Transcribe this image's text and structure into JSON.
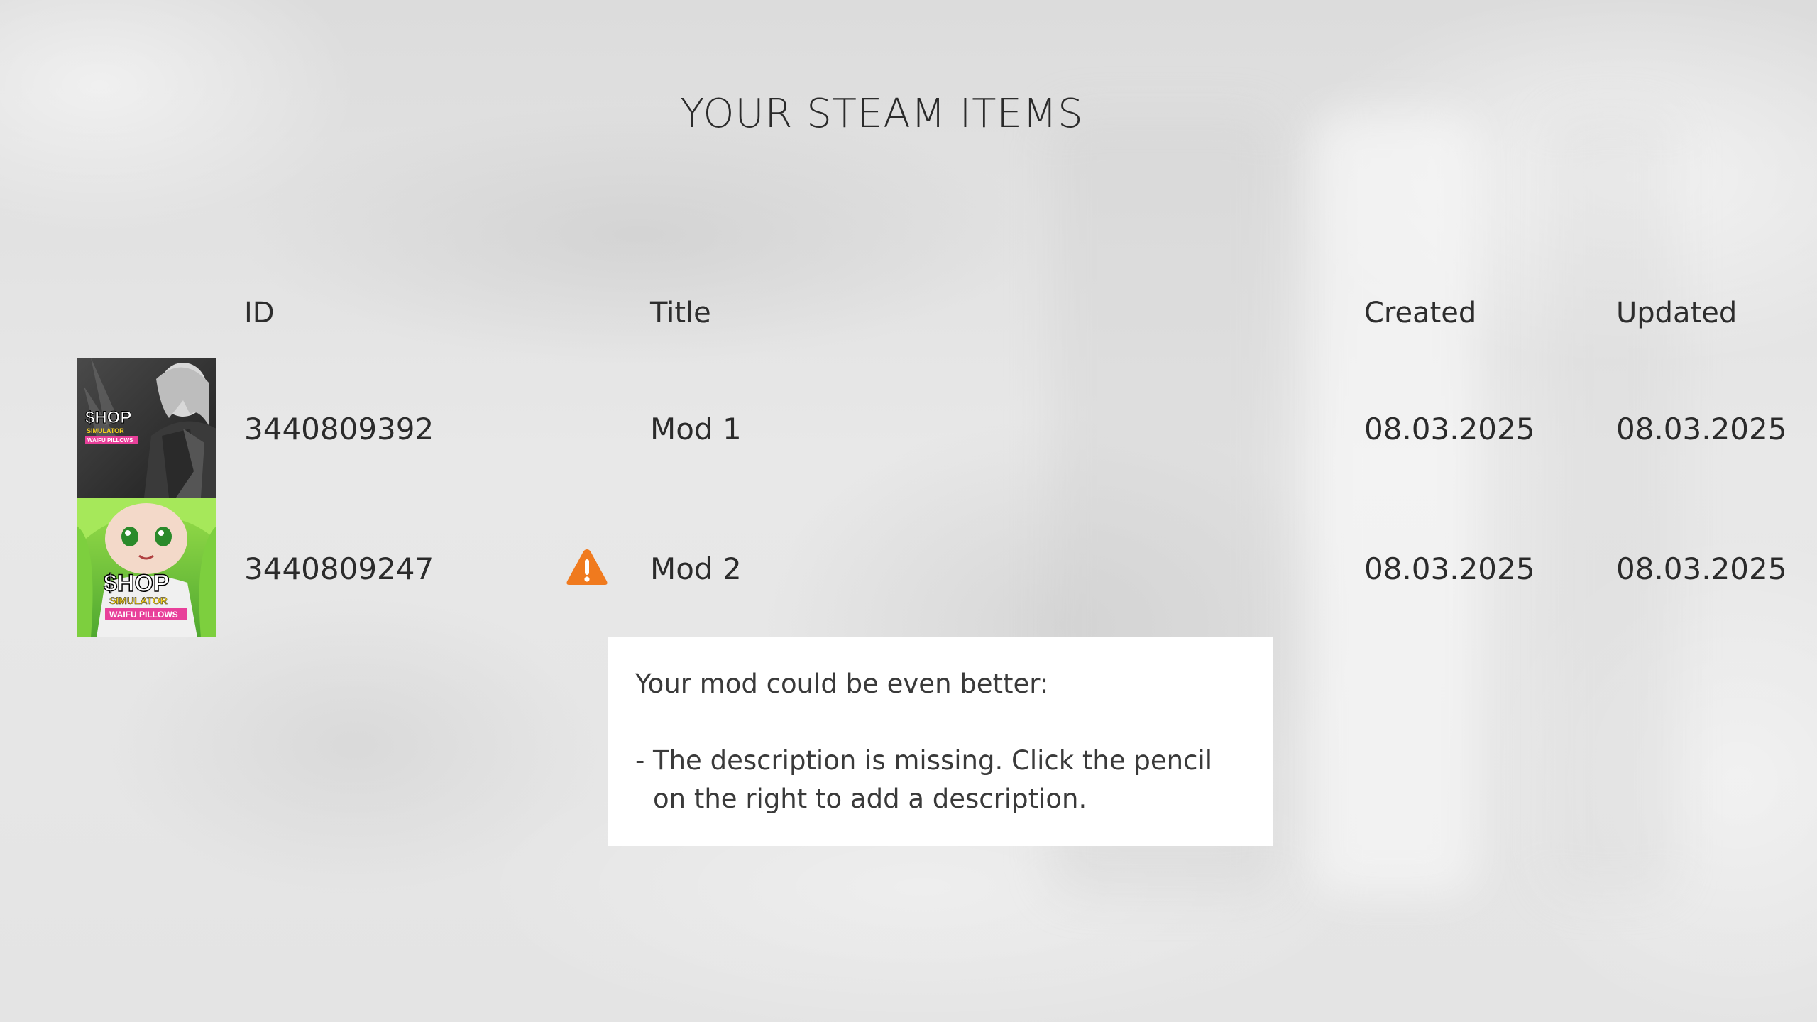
{
  "page": {
    "title": "YOUR STEAM ITEMS"
  },
  "table": {
    "columns": {
      "id": "ID",
      "title": "Title",
      "created": "Created",
      "updated": "Updated"
    },
    "rows": [
      {
        "id": "3440809392",
        "title": "Mod 1",
        "created": "08.03.2025",
        "updated": "08.03.2025",
        "warning": false,
        "thumbnail": {
          "logo_line1": "$HOP",
          "logo_line2": "SIMULATOR",
          "logo_line3": "WAIFU PILLOWS",
          "style": "grayscale"
        }
      },
      {
        "id": "3440809247",
        "title": "Mod 2",
        "created": "08.03.2025",
        "updated": "08.03.2025",
        "warning": true,
        "warning_icon": "warning-triangle-icon",
        "thumbnail": {
          "logo_line1": "$HOP",
          "logo_line2": "SIMULATOR",
          "logo_line3": "WAIFU PILLOWS",
          "style": "green"
        }
      }
    ]
  },
  "tooltip": {
    "heading": "Your mod could be even better:",
    "item_prefix": "-",
    "item": "The description is missing. Click the pencil on the right to add a description."
  },
  "colors": {
    "warning": "#f07a1e",
    "tooltip_bg": "#ffffff",
    "text": "#2b2b2b"
  }
}
